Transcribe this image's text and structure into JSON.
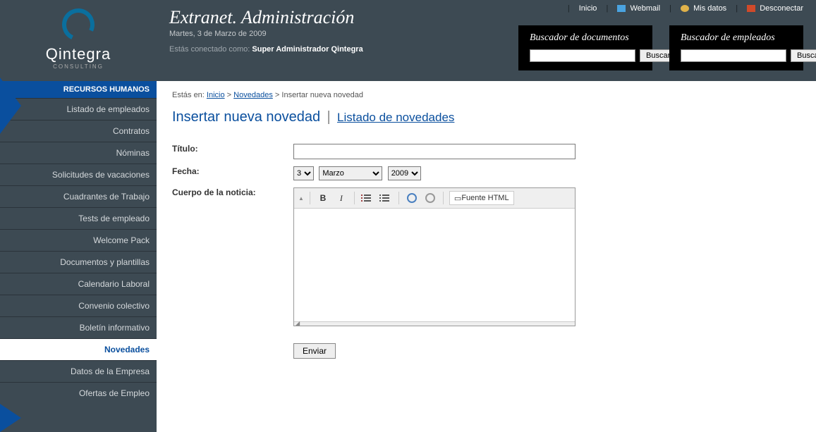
{
  "brand": {
    "name": "Qintegra",
    "sub": "CONSULTING"
  },
  "header": {
    "title": "Extranet. Administración",
    "date": "Martes, 3 de Marzo de 2009",
    "connected_prefix": "Estás conectado como:",
    "connected_user": "Super Administrador Qintegra"
  },
  "util_nav": {
    "inicio": "Inicio",
    "webmail": "Webmail",
    "mis_datos": "Mis datos",
    "desconectar": "Desconectar"
  },
  "search": {
    "docs": {
      "title": "Buscador de documentos",
      "btn": "Buscar"
    },
    "emps": {
      "title": "Buscador de empleados",
      "btn": "Buscar"
    }
  },
  "sidebar": {
    "category": "RECURSOS HUMANOS",
    "items": [
      "Listado de empleados",
      "Contratos",
      "Nóminas",
      "Solicitudes de vacaciones",
      "Cuadrantes de Trabajo",
      "Tests de empleado",
      "Welcome Pack",
      "Documentos y plantillas",
      "Calendario Laboral",
      "Convenio colectivo",
      "Boletín informativo",
      "Novedades",
      "Datos de la Empresa",
      "Ofertas de Empleo"
    ],
    "active_index": 11
  },
  "breadcrumbs": {
    "prefix": "Estás en:",
    "inicio": "Inicio",
    "novedades": "Novedades",
    "current": "Insertar nueva novedad",
    "sep": ">"
  },
  "page": {
    "h1": "Insertar nueva novedad",
    "h1_link": "Listado de novedades"
  },
  "form": {
    "titulo_label": "Título:",
    "titulo_value": "",
    "fecha_label": "Fecha:",
    "fecha_day": "3",
    "fecha_month": "Marzo",
    "fecha_year": "2009",
    "cuerpo_label": "Cuerpo de la noticia:",
    "toolbar_source": "Fuente HTML",
    "submit": "Enviar"
  }
}
